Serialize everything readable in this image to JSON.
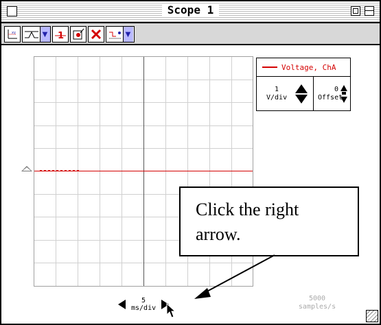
{
  "window": {
    "title": "Scope 1"
  },
  "toolbar": {
    "buttons": [
      {
        "icon": "axes-icon"
      },
      {
        "icon": "trigger-icon"
      },
      {
        "icon": "reference-icon"
      },
      {
        "icon": "probe-icon"
      },
      {
        "icon": "delete-icon"
      },
      {
        "icon": "display-icon"
      }
    ]
  },
  "channel": {
    "name": "Voltage, ChA",
    "color": "#d40000",
    "volts_per_div_value": "1",
    "volts_per_div_unit": "V/div",
    "offset_value": "0",
    "offset_label": "Offset"
  },
  "timebase": {
    "value": "5",
    "unit": "ms/div"
  },
  "sample_rate": {
    "value": "5000",
    "unit": "samples/s"
  },
  "callout": {
    "line1": "Click the right",
    "line2": "arrow."
  }
}
